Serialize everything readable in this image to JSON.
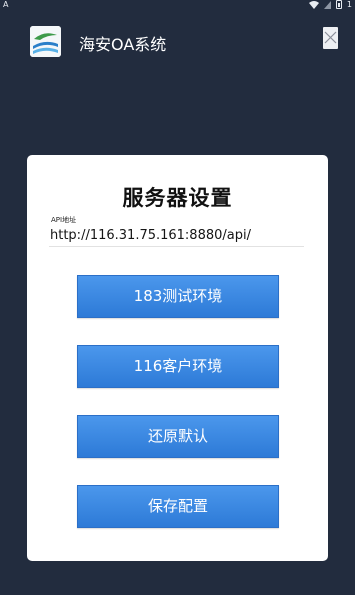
{
  "status_bar": {
    "left_glyph": "A",
    "battery_level": "1"
  },
  "header": {
    "app_title": "海安OA系统"
  },
  "dialog": {
    "title": "服务器设置",
    "api_label": "API地址",
    "api_value": "http://116.31.75.161:8880/api/",
    "buttons": [
      {
        "label": "183测试环境"
      },
      {
        "label": "116客户环境"
      },
      {
        "label": "还原默认"
      },
      {
        "label": "保存配置"
      }
    ]
  },
  "colors": {
    "background": "#222c3e",
    "button": "#3a87e3",
    "dialog": "#ffffff"
  }
}
